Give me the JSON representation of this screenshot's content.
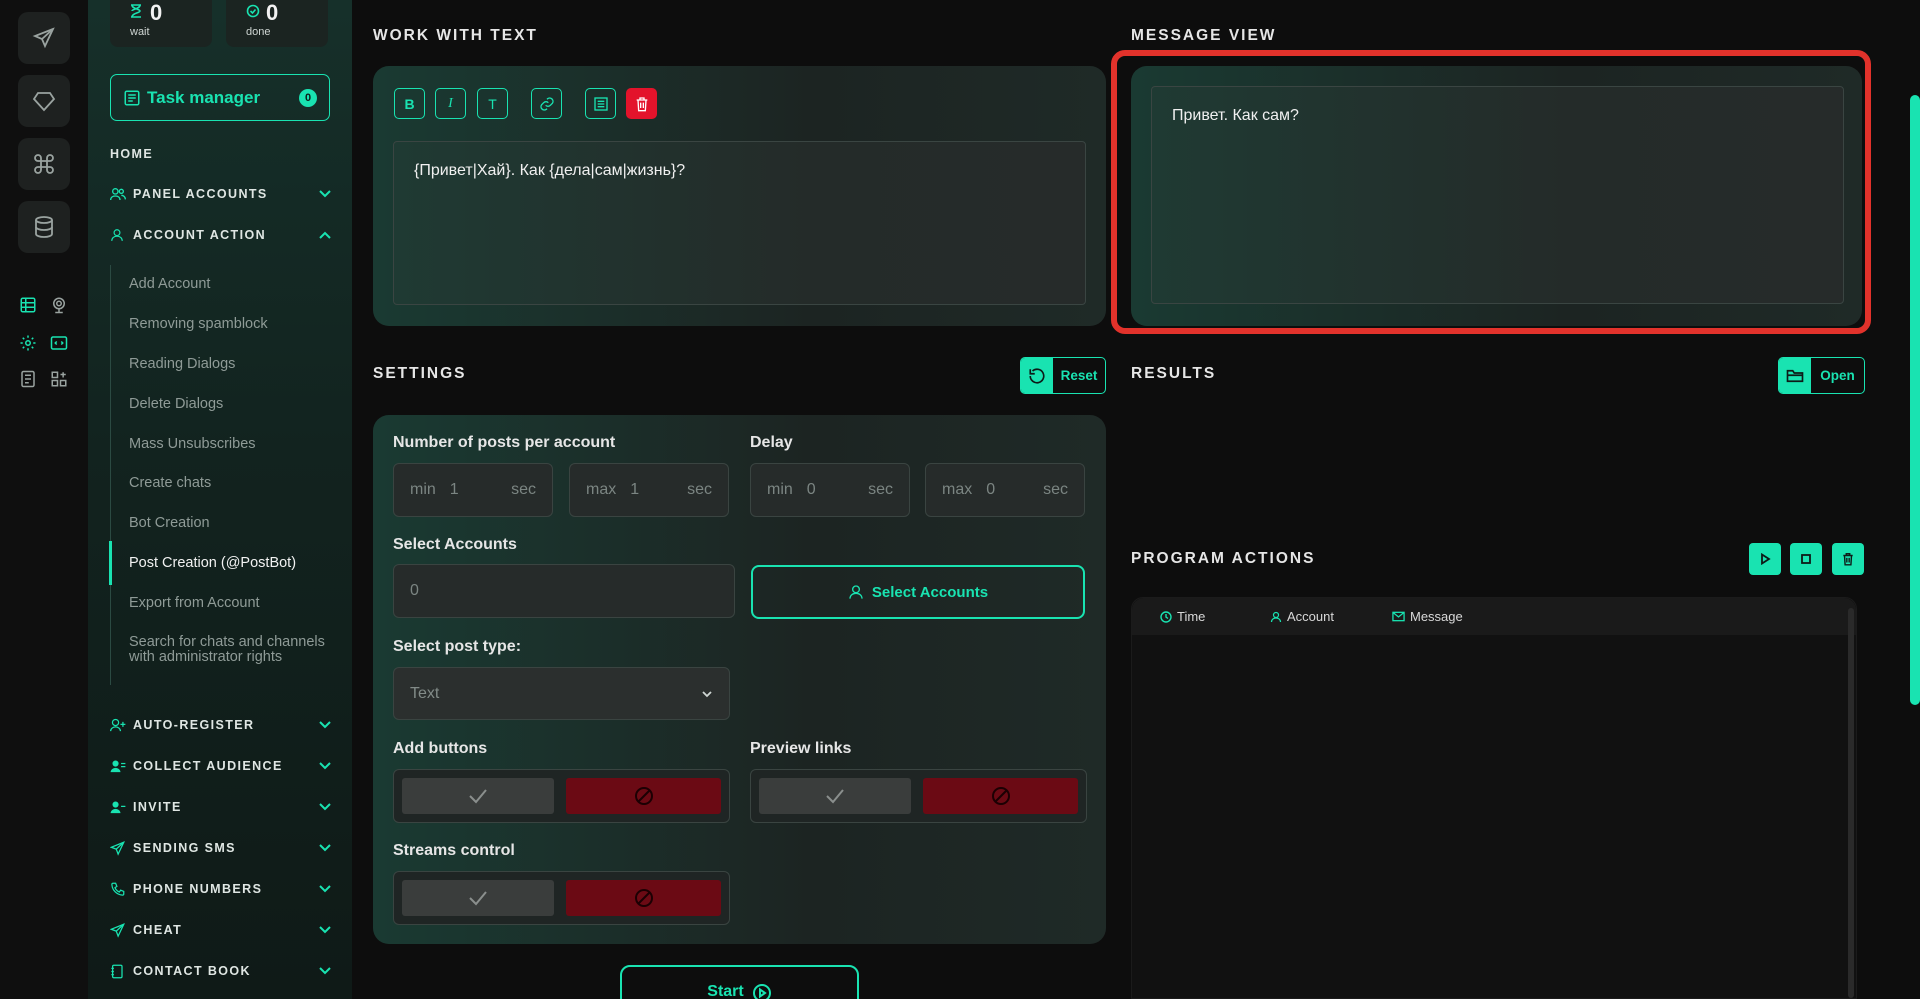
{
  "colors": {
    "accent": "#19e3b1",
    "danger": "#e3132b",
    "highlight": "#e2322b"
  },
  "counters": [
    {
      "value": "0",
      "label": "wait",
      "icon": "hourglass-icon"
    },
    {
      "value": "0",
      "label": "done",
      "icon": "check-circle-icon"
    }
  ],
  "task_manager": {
    "label": "Task manager",
    "badge": "0"
  },
  "nav": {
    "home": "HOME",
    "panel_accounts": "PANEL ACCOUNTS",
    "account_action": "ACCOUNT ACTION",
    "sub_items": [
      "Add Account",
      "Removing spamblock",
      "Reading Dialogs",
      "Delete Dialogs",
      "Mass Unsubscribes",
      "Create chats",
      "Bot Creation",
      "Post Creation (@PostBot)",
      "Export from Account",
      "Search for chats and channels with administrator rights"
    ],
    "active_sub": "Post Creation (@PostBot)",
    "groups": [
      "AUTO-REGISTER",
      "COLLECT AUDIENCE",
      "INVITE",
      "SENDING SMS",
      "PHONE NUMBERS",
      "CHEAT",
      "CONTACT BOOK"
    ]
  },
  "work_with_text": {
    "title": "WORK WITH TEXT",
    "format_buttons": [
      "B",
      "I",
      "T"
    ],
    "text": "{Привет|Хай}. Как {дела|сам|жизнь}?"
  },
  "message_view": {
    "title": "MESSAGE VIEW",
    "text": "Привет. Как сам?"
  },
  "settings": {
    "title": "SETTINGS",
    "reset_label": "Reset",
    "posts_label": "Number of posts per account",
    "delay_label": "Delay",
    "posts_min": {
      "prefix": "min",
      "value": "1",
      "unit": "sec"
    },
    "posts_max": {
      "prefix": "max",
      "value": "1",
      "unit": "sec"
    },
    "delay_min": {
      "prefix": "min",
      "value": "0",
      "unit": "sec"
    },
    "delay_max": {
      "prefix": "max",
      "value": "0",
      "unit": "sec"
    },
    "select_accounts_label": "Select Accounts",
    "accounts_value": "0",
    "select_accounts_button": "Select Accounts",
    "post_type_label": "Select post type:",
    "post_type_value": "Text",
    "add_buttons_label": "Add buttons",
    "preview_links_label": "Preview links",
    "streams_label": "Streams control",
    "start_label": "Start"
  },
  "results": {
    "title": "RESULTS",
    "open_label": "Open"
  },
  "program_actions": {
    "title": "PROGRAM ACTIONS",
    "columns": [
      "Time",
      "Account",
      "Message"
    ]
  }
}
